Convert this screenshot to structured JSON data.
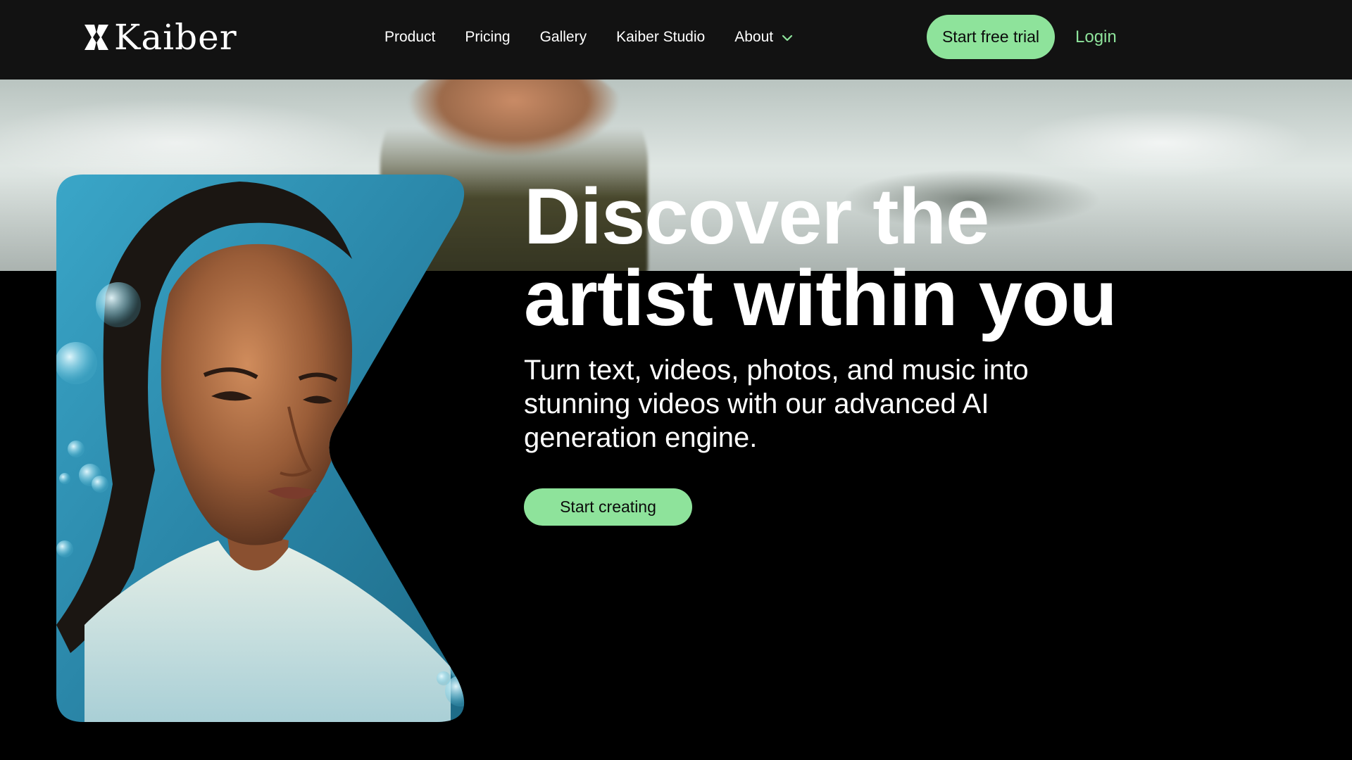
{
  "brand": {
    "name": "Kaiber"
  },
  "nav": {
    "items": [
      {
        "label": "Product"
      },
      {
        "label": "Pricing"
      },
      {
        "label": "Gallery"
      },
      {
        "label": "Kaiber Studio"
      },
      {
        "label": "About",
        "icon": "chevron-down-icon"
      }
    ],
    "cta_label": "Start free trial",
    "login_label": "Login"
  },
  "hero": {
    "headline_line1": "Discover the",
    "headline_line2": "artist within you",
    "subtitle": "Turn text, videos, photos, and music into stunning videos with our advanced AI generation engine.",
    "cta_label": "Start creating"
  },
  "colors": {
    "accent": "#8ee39b",
    "nav_bg": "#121212",
    "page_bg": "#000000",
    "text": "#ffffff"
  }
}
